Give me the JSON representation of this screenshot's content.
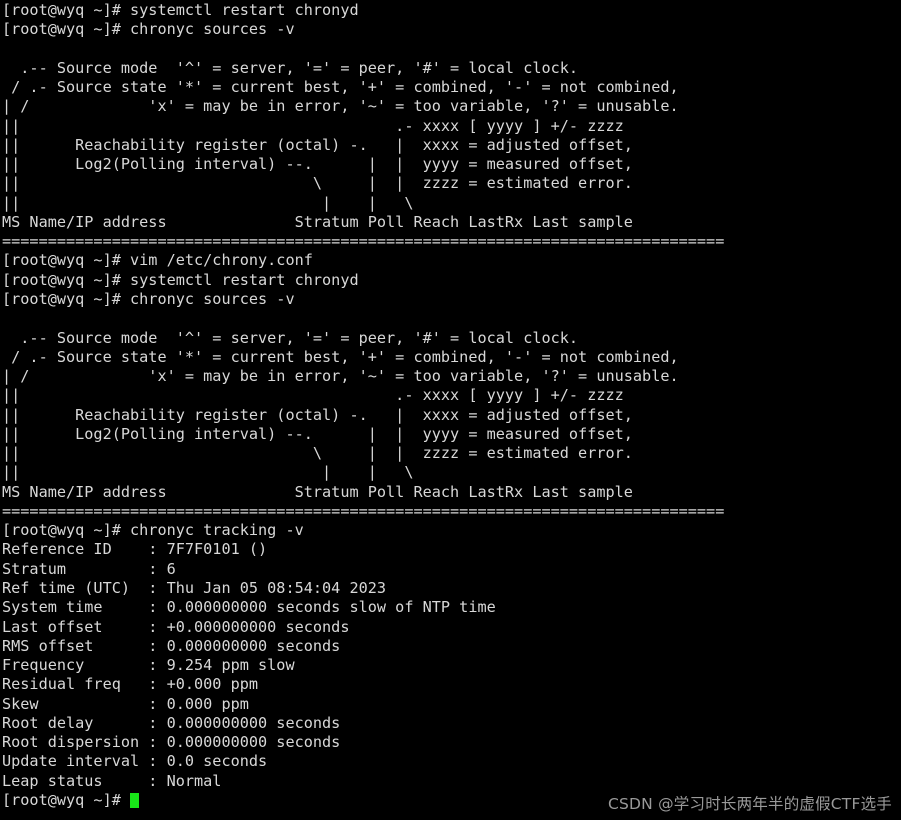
{
  "terminal": {
    "background_color": "#000000",
    "foreground_color": "#d8d8d8",
    "cursor_color": "#18e618",
    "prompt": "[root@wyq ~]#",
    "lines": [
      "[root@wyq ~]# systemctl restart chronyd",
      "[root@wyq ~]# chronyc sources -v",
      "",
      "  .-- Source mode  '^' = server, '=' = peer, '#' = local clock.",
      " / .- Source state '*' = current best, '+' = combined, '-' = not combined,",
      "| /             'x' = may be in error, '~' = too variable, '?' = unusable.",
      "||                                         .- xxxx [ yyyy ] +/- zzzz",
      "||      Reachability register (octal) -.   |  xxxx = adjusted offset,",
      "||      Log2(Polling interval) --.      |  |  yyyy = measured offset,",
      "||                                \\     |  |  zzzz = estimated error.",
      "||                                 |    |   \\",
      "MS Name/IP address              Stratum Poll Reach LastRx Last sample",
      "===============================================================================",
      "[root@wyq ~]# vim /etc/chrony.conf",
      "[root@wyq ~]# systemctl restart chronyd",
      "[root@wyq ~]# chronyc sources -v",
      "",
      "  .-- Source mode  '^' = server, '=' = peer, '#' = local clock.",
      " / .- Source state '*' = current best, '+' = combined, '-' = not combined,",
      "| /             'x' = may be in error, '~' = too variable, '?' = unusable.",
      "||                                         .- xxxx [ yyyy ] +/- zzzz",
      "||      Reachability register (octal) -.   |  xxxx = adjusted offset,",
      "||      Log2(Polling interval) --.      |  |  yyyy = measured offset,",
      "||                                \\     |  |  zzzz = estimated error.",
      "||                                 |    |   \\",
      "MS Name/IP address              Stratum Poll Reach LastRx Last sample",
      "===============================================================================",
      "[root@wyq ~]# chronyc tracking -v",
      "Reference ID    : 7F7F0101 ()",
      "Stratum         : 6",
      "Ref time (UTC)  : Thu Jan 05 08:54:04 2023",
      "System time     : 0.000000000 seconds slow of NTP time",
      "Last offset     : +0.000000000 seconds",
      "RMS offset      : 0.000000000 seconds",
      "Frequency       : 9.254 ppm slow",
      "Residual freq   : +0.000 ppm",
      "Skew            : 0.000 ppm",
      "Root delay      : 0.000000000 seconds",
      "Root dispersion : 0.000000000 seconds",
      "Update interval : 0.0 seconds",
      "Leap status     : Normal"
    ],
    "final_prompt": "[root@wyq ~]# ",
    "commands": [
      "systemctl restart chronyd",
      "chronyc sources -v",
      "vim /etc/chrony.conf",
      "chronyc tracking -v"
    ],
    "tracking": {
      "Reference ID": "7F7F0101 ()",
      "Stratum": "6",
      "Ref time (UTC)": "Thu Jan 05 08:54:04 2023",
      "System time": "0.000000000 seconds slow of NTP time",
      "Last offset": "+0.000000000 seconds",
      "RMS offset": "0.000000000 seconds",
      "Frequency": "9.254 ppm slow",
      "Residual freq": "+0.000 ppm",
      "Skew": "0.000 ppm",
      "Root delay": "0.000000000 seconds",
      "Root dispersion": "0.000000000 seconds",
      "Update interval": "0.0 seconds",
      "Leap status": "Normal"
    },
    "sources_table_headers": "MS Name/IP address              Stratum Poll Reach LastRx Last sample"
  },
  "watermark": {
    "text": "CSDN @学习时长两年半的虚假CTF选手",
    "color": "#9a9a9a"
  }
}
